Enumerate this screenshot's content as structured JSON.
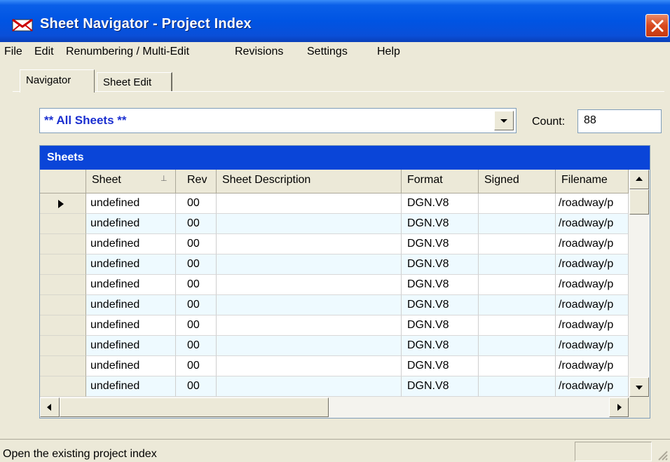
{
  "window": {
    "title": "Sheet Navigator - Project Index"
  },
  "menu": [
    "File",
    "Edit",
    "Renumbering / Multi-Edit",
    "Revisions",
    "Settings",
    "Help"
  ],
  "tabs": [
    {
      "label": "Navigator",
      "active": true
    },
    {
      "label": "Sheet Edit",
      "active": false
    }
  ],
  "filter": {
    "selected": "** All Sheets **",
    "count_label": "Count:",
    "count_value": "88"
  },
  "grid": {
    "caption": "Sheets",
    "columns": [
      "Sheet",
      "Rev",
      "Sheet Description",
      "Format",
      "Signed",
      "Filename"
    ],
    "sort_indicator": "⊥",
    "rows": [
      {
        "sheet": "undefined",
        "rev": "00",
        "description": "",
        "format": "DGN.V8",
        "signed": "",
        "filename": "/roadway/p"
      },
      {
        "sheet": "undefined",
        "rev": "00",
        "description": "",
        "format": "DGN.V8",
        "signed": "",
        "filename": "/roadway/p"
      },
      {
        "sheet": "undefined",
        "rev": "00",
        "description": "",
        "format": "DGN.V8",
        "signed": "",
        "filename": "/roadway/p"
      },
      {
        "sheet": "undefined",
        "rev": "00",
        "description": "",
        "format": "DGN.V8",
        "signed": "",
        "filename": "/roadway/p"
      },
      {
        "sheet": "undefined",
        "rev": "00",
        "description": "",
        "format": "DGN.V8",
        "signed": "",
        "filename": "/roadway/p"
      },
      {
        "sheet": "undefined",
        "rev": "00",
        "description": "",
        "format": "DGN.V8",
        "signed": "",
        "filename": "/roadway/p"
      },
      {
        "sheet": "undefined",
        "rev": "00",
        "description": "",
        "format": "DGN.V8",
        "signed": "",
        "filename": "/roadway/p"
      },
      {
        "sheet": "undefined",
        "rev": "00",
        "description": "",
        "format": "DGN.V8",
        "signed": "",
        "filename": "/roadway/p"
      },
      {
        "sheet": "undefined",
        "rev": "00",
        "description": "",
        "format": "DGN.V8",
        "signed": "",
        "filename": "/roadway/p"
      },
      {
        "sheet": "undefined",
        "rev": "00",
        "description": "",
        "format": "DGN.V8",
        "signed": "",
        "filename": "/roadway/p"
      }
    ],
    "current_row": 0
  },
  "status": {
    "text": "Open the existing project index"
  },
  "colors": {
    "titlebar": "#0054e3",
    "grid_caption": "#0a45d8",
    "combo_text": "#1b2fd0",
    "row_alt": "#eefaff",
    "close": "#d8481e"
  },
  "icons": [
    "app-icon",
    "close-icon",
    "dropdown-arrow-icon",
    "current-row-icon",
    "scroll-up-icon",
    "scroll-down-icon",
    "scroll-left-icon",
    "scroll-right-icon",
    "size-grip-icon"
  ]
}
